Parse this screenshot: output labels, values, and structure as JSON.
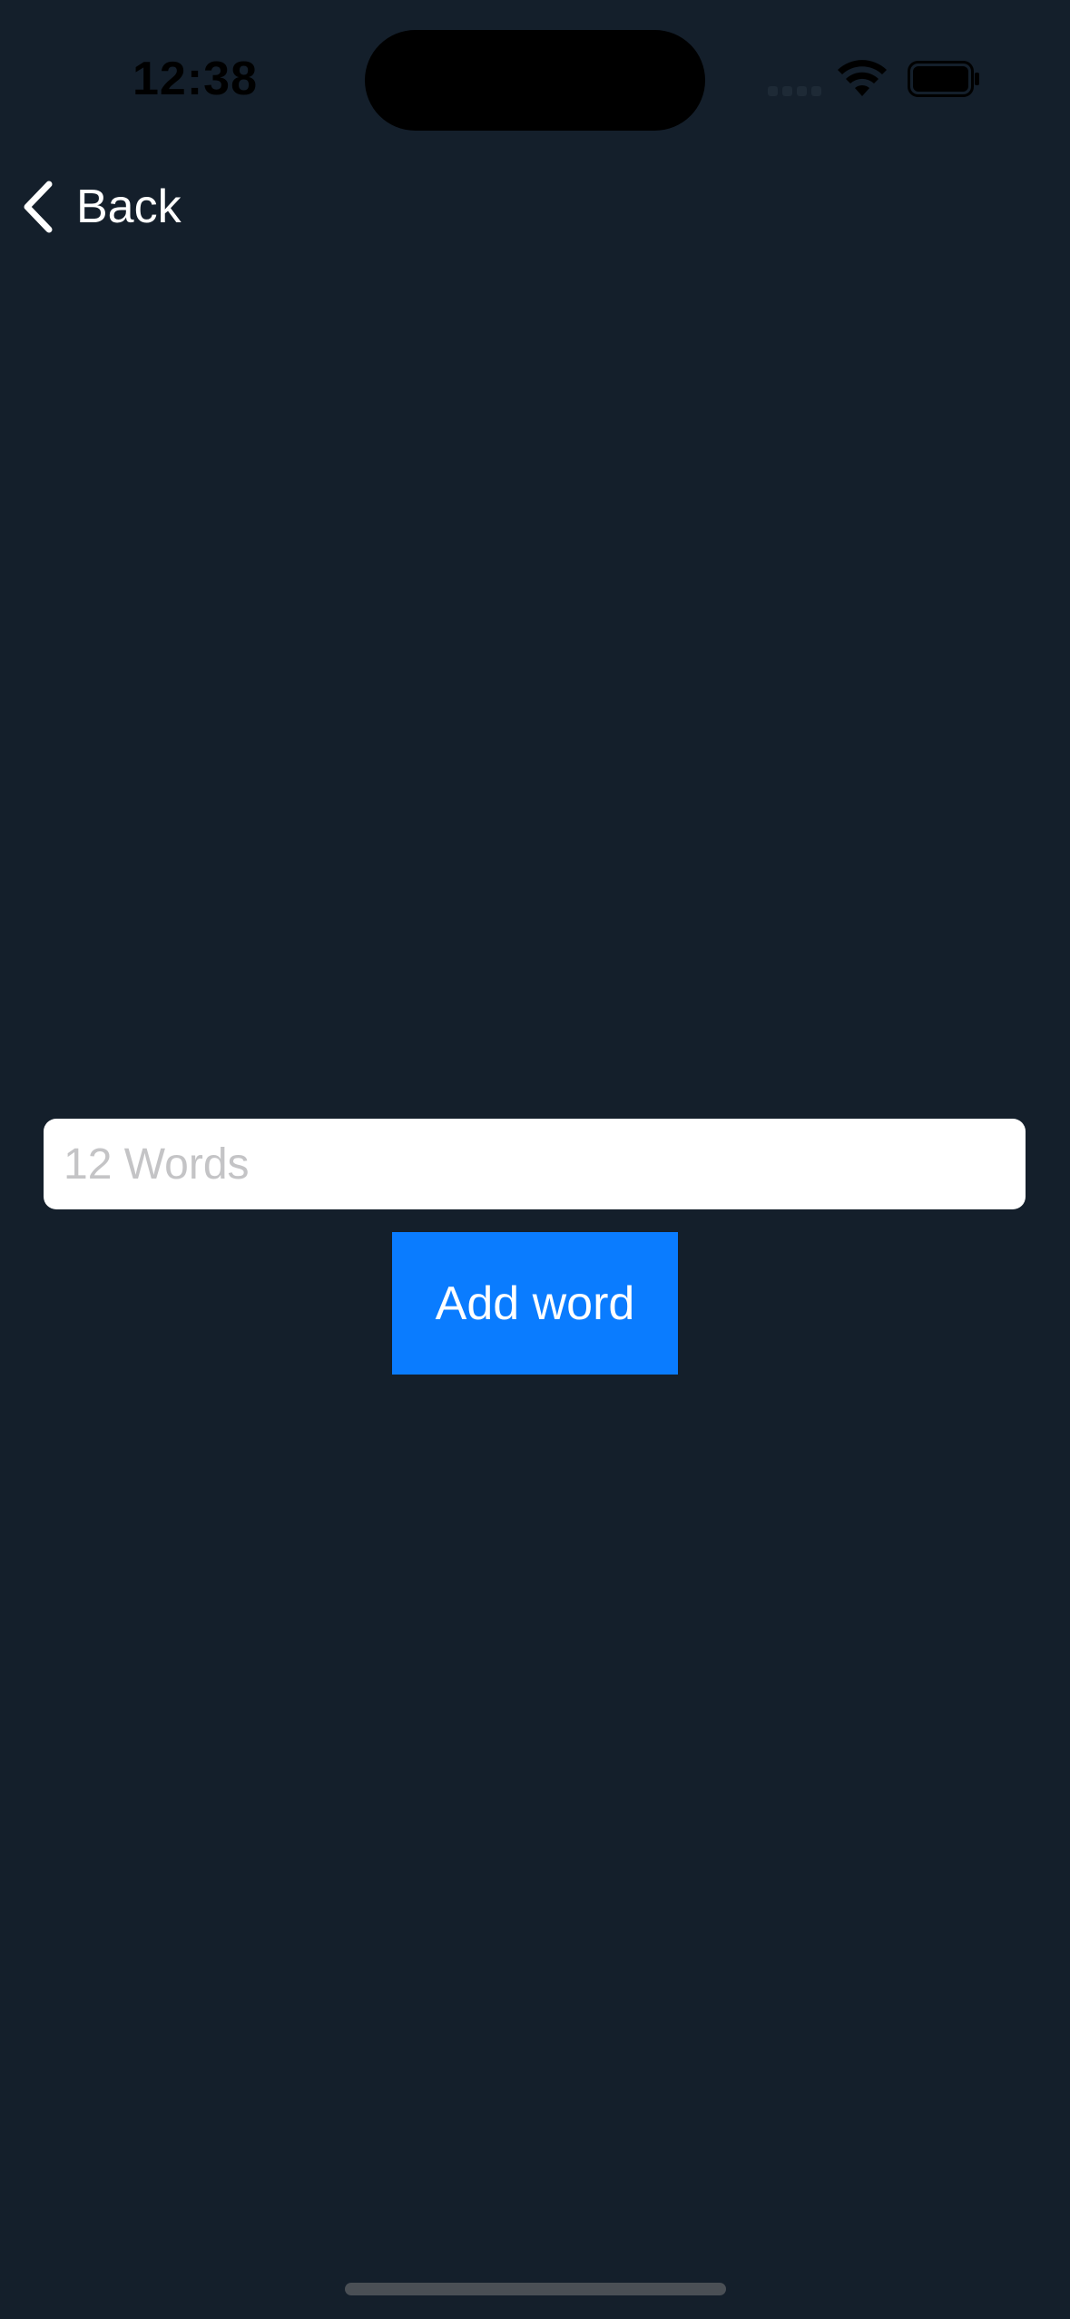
{
  "status_bar": {
    "time": "12:38",
    "icons": [
      "signal-icon",
      "wifi-icon",
      "battery-icon"
    ]
  },
  "nav": {
    "back_label": "Back",
    "back_icon": "chevron-left-icon"
  },
  "form": {
    "input_value": "",
    "input_placeholder": "12 Words",
    "add_button_label": "Add word"
  },
  "colors": {
    "background": "#141f2b",
    "accent": "#0a7cff",
    "input_background": "#ffffff",
    "placeholder": "#c4c4c6"
  }
}
